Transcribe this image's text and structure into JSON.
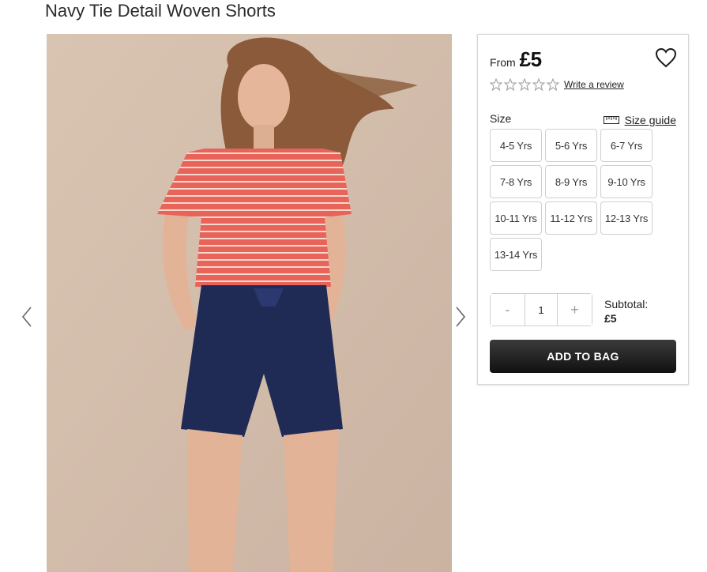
{
  "product": {
    "title": "Navy Tie Detail Woven Shorts",
    "image_alt": "Girl wearing coral striped top and navy woven shorts"
  },
  "gallery": {
    "prev_icon": "chevron-left-icon",
    "next_icon": "chevron-right-icon"
  },
  "price": {
    "from_label": "From",
    "value": "£5"
  },
  "wishlist": {
    "icon": "heart-icon"
  },
  "rating": {
    "stars_filled": 0,
    "stars_total": 5,
    "write_review_label": "Write a review"
  },
  "size": {
    "label": "Size",
    "guide_label": "Size guide",
    "guide_icon": "ruler-icon",
    "options": [
      "4-5 Yrs",
      "5-6 Yrs",
      "6-7 Yrs",
      "7-8 Yrs",
      "8-9 Yrs",
      "9-10 Yrs",
      "10-11 Yrs",
      "11-12 Yrs",
      "12-13 Yrs",
      "13-14 Yrs"
    ]
  },
  "quantity": {
    "minus_label": "-",
    "value": "1",
    "plus_label": "+"
  },
  "subtotal": {
    "label": "Subtotal:",
    "value": "£5"
  },
  "add_to_bag": {
    "label": "ADD TO BAG"
  },
  "colors": {
    "button_dark": "#1a1a1a",
    "border": "#cfcfcf",
    "photo_background": "#d7c2b1",
    "top_coral": "#e8645a",
    "shorts_navy": "#1f2a55"
  }
}
